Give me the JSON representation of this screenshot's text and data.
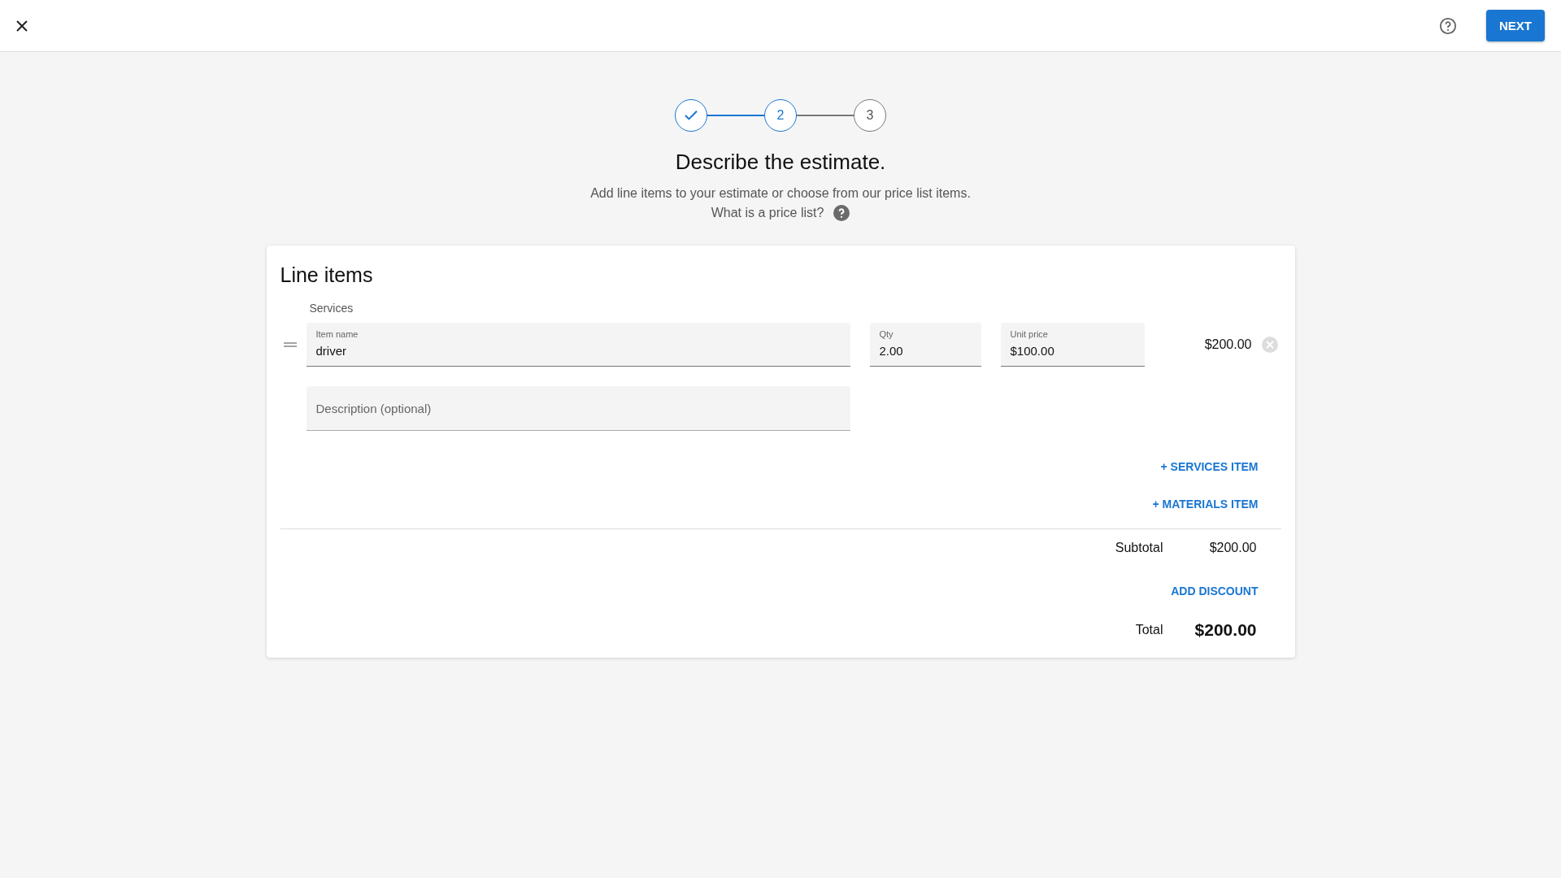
{
  "top_bar": {
    "next_button": "NEXT"
  },
  "steps": [
    {
      "kind": "completed"
    },
    {
      "kind": "current",
      "label": "2"
    },
    {
      "kind": "upcoming",
      "label": "3"
    }
  ],
  "heading": "Describe the estimate.",
  "intro": "Add line items to your estimate or choose from our price list items.",
  "price_list_link": "What is a price list?",
  "line_items": {
    "title": "Line items",
    "section": "Services",
    "items": [
      {
        "name_label": "Item name",
        "name": "driver",
        "qty_label": "Qty",
        "qty": "2.00",
        "price_label": "Unit price",
        "price": "$100.00",
        "amount": "$200.00",
        "description_placeholder": "Description (optional)"
      }
    ],
    "add_buttons": [
      "+ SERVICES ITEM",
      "+ MATERIALS ITEM"
    ],
    "subtotal_label": "Subtotal",
    "subtotal": "$200.00",
    "discount_button": "ADD DISCOUNT",
    "total_label": "Total",
    "total": "$200.00"
  }
}
